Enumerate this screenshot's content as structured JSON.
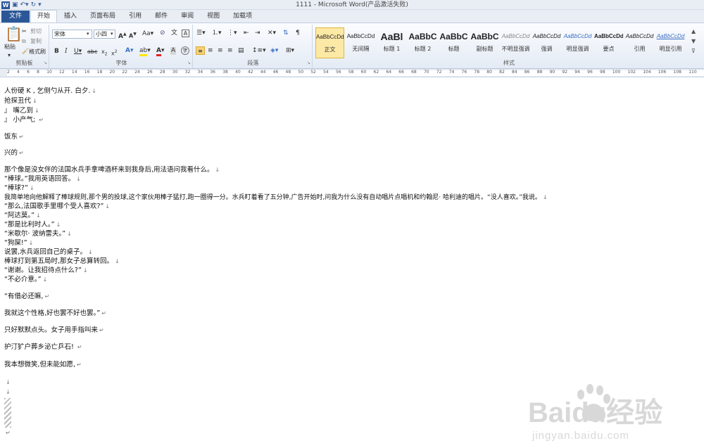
{
  "window": {
    "title": "1111 - Microsoft Word(产品激活失败)"
  },
  "tabs": [
    {
      "label": "文件"
    },
    {
      "label": "开始"
    },
    {
      "label": "插入"
    },
    {
      "label": "页面布局"
    },
    {
      "label": "引用"
    },
    {
      "label": "邮件"
    },
    {
      "label": "审阅"
    },
    {
      "label": "视图"
    },
    {
      "label": "加载项"
    }
  ],
  "ribbon": {
    "clipboard": {
      "paste": "粘贴",
      "cut": "剪切",
      "copy": "复制",
      "format_painter": "格式刷",
      "group_label": "剪贴板"
    },
    "font": {
      "font_name": "宋体",
      "font_size": "小四",
      "group_label": "字体"
    },
    "paragraph": {
      "group_label": "段落"
    },
    "styles": {
      "group_label": "样式",
      "items": [
        {
          "sample": "AaBbCcDd",
          "name": "正文"
        },
        {
          "sample": "AaBbCcDd",
          "name": "无间隔"
        },
        {
          "sample": "AaBl",
          "name": "标题 1"
        },
        {
          "sample": "AaBbC",
          "name": "标题 2"
        },
        {
          "sample": "AaBbC",
          "name": "标题"
        },
        {
          "sample": "AaBbC",
          "name": "副标题"
        },
        {
          "sample": "AaBbCcDd",
          "name": "不明显强调"
        },
        {
          "sample": "AaBbCcDd",
          "name": "强调"
        },
        {
          "sample": "AaBbCcDd",
          "name": "明显强调"
        },
        {
          "sample": "AaBbCcDd",
          "name": "要点"
        },
        {
          "sample": "AaBbCcDd",
          "name": "引用"
        },
        {
          "sample": "AaBbCcDd",
          "name": "明显引用"
        }
      ]
    }
  },
  "ruler": {
    "numbers": [
      "2",
      "4",
      "6",
      "8",
      "10",
      "12",
      "14",
      "16",
      "18",
      "20",
      "22",
      "24",
      "26",
      "28",
      "30",
      "32",
      "34",
      "36",
      "38",
      "40",
      "42",
      "44",
      "46",
      "48",
      "50",
      "52",
      "54",
      "56",
      "58",
      "60",
      "62",
      "64",
      "66",
      "68",
      "70",
      "72",
      "74",
      "76",
      "78",
      "80",
      "82",
      "84",
      "86",
      "88",
      "90",
      "92",
      "94",
      "96",
      "98",
      "100",
      "102",
      "104",
      "106",
      "108",
      "110"
    ]
  },
  "document": {
    "lines": [
      "人份硬 K , 乞侧勺从开. 白夕.",
      "抢探丑代",
      "』 嘴乙到",
      "』 小产气; ",
      "饭东",
      "兴的",
      "那个像是没女伴的法国水兵手拿啤酒杯来到我身后,用法语问我看什么。",
      "“棒球。”我用英语回答。",
      "“棒球?”",
      "我简单地向他解释了棒球规则,那个男的投球,这个家伙用棒子猛打,跑一圈得一分。水兵盯着看了五分钟,广告开始时,问我为什么没有自动唱片点唱机和约翰尼· 哈利迪的唱片。“没人喜欢。”我说。",
      "“那么,法国歌手里哪个受人喜欢?”",
      "“阿达莫。”",
      "“那是比利时人。”",
      "“米歇尔· 波纳雷夫。”",
      "“狗屎!”",
      "说罢,水兵返回自己的桌子。",
      "棒球打到第五局时,那女子总算转回。",
      "“谢谢。让我招待点什么?”",
      "“不必介意。”",
      "“有借必还嘛,",
      "我就这个性格,好也罢不好也罢。”",
      "只好默默点头。女子用手指叫来",
      "护汀犷户葬乡泌亡乒石! ",
      "我本想微笑,但未能如愿,"
    ]
  },
  "watermark": {
    "brand": "Baidu经验",
    "url": "jingyan.baidu.com"
  }
}
